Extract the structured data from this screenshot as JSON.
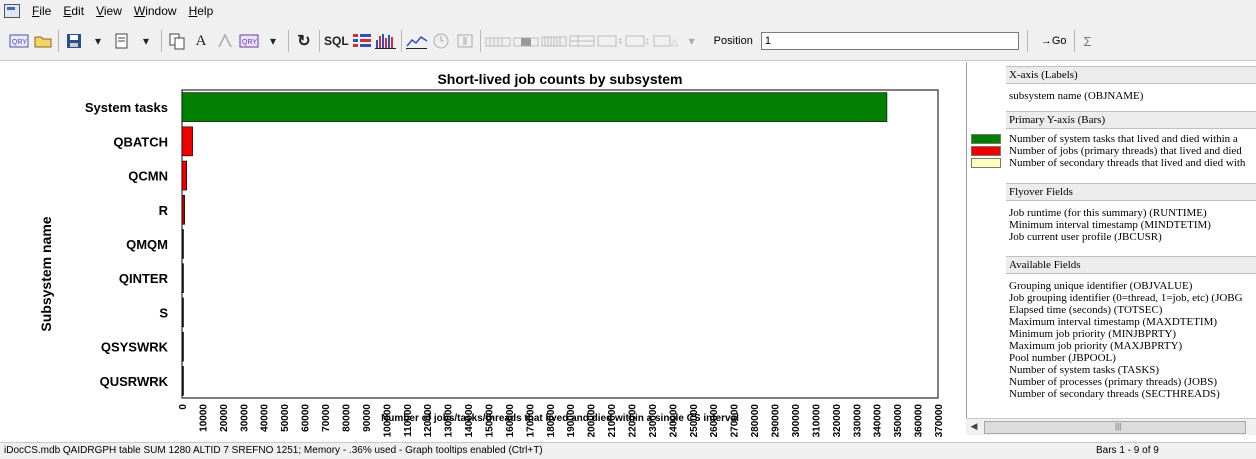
{
  "menu": {
    "items": [
      {
        "label": "File",
        "accel": "F",
        "rest": "ile"
      },
      {
        "label": "Edit",
        "accel": "E",
        "rest": "dit"
      },
      {
        "label": "View",
        "accel": "V",
        "rest": "iew"
      },
      {
        "label": "Window",
        "accel": "W",
        "rest": "indow"
      },
      {
        "label": "Help",
        "accel": "H",
        "rest": "elp"
      }
    ]
  },
  "toolbar": {
    "sql_label": "SQL",
    "position_label": "Position",
    "position_value": "1",
    "go_label": "→Go",
    "sigma_label": "Σ"
  },
  "chart_data": {
    "type": "bar",
    "orientation": "horizontal",
    "title": "Short-lived job counts by subsystem",
    "xlabel": "Number of jobs/tasks/threads that lived and died within a single CS interval",
    "ylabel": "Subsystem name",
    "categories": [
      "System tasks",
      "QBATCH",
      "QCMN",
      "R",
      "QMQM",
      "QINTER",
      "S",
      "QSYSWRK",
      "QUSRWRK"
    ],
    "series": [
      {
        "values": [
          345000,
          5200,
          2300,
          1300,
          600,
          450,
          350,
          150,
          100
        ],
        "color": "#007f00"
      }
    ],
    "bar_colors": [
      "#007f00",
      "#ee0000",
      "#ee0000",
      "#c00000",
      "#222222",
      "#222222",
      "#222222",
      "#222222",
      "#222222"
    ],
    "xlim": [
      0,
      370000
    ],
    "xticks": [
      0,
      10000,
      20000,
      30000,
      40000,
      50000,
      60000,
      70000,
      80000,
      90000,
      100000,
      110000,
      120000,
      130000,
      140000,
      150000,
      160000,
      170000,
      180000,
      190000,
      200000,
      210000,
      220000,
      230000,
      240000,
      250000,
      260000,
      270000,
      280000,
      290000,
      300000,
      310000,
      320000,
      330000,
      340000,
      350000,
      360000,
      370000
    ],
    "grid": false
  },
  "legend": {
    "xaxis_header": "X-axis (Labels)",
    "xaxis_field": "subsystem name (OBJNAME)",
    "yaxis_header": "Primary Y-axis (Bars)",
    "bars": [
      {
        "label": "Number of system tasks that lived and died within a",
        "color": "#007f00"
      },
      {
        "label": "Number of jobs (primary threads) that lived and died",
        "color": "#ee0000"
      },
      {
        "label": "Number of secondary threads that lived and died with",
        "color": "#ffffc0"
      }
    ],
    "flyover_header": "Flyover Fields",
    "flyover_fields": [
      "Job runtime (for this summary) (RUNTIME)",
      "Minimum interval timestamp (MINDTETIM)",
      "Job current user profile (JBCUSR)"
    ],
    "available_header": "Available Fields",
    "available_fields": [
      "Grouping unique identifier (OBJVALUE)",
      "Job grouping identifier (0=thread, 1=job, etc) (JOBG",
      "Elapsed time (seconds) (TOTSEC)",
      "Maximum interval timestamp (MAXDTETIM)",
      "Minimum job priority (MINJBPRTY)",
      "Maximum job priority (MAXJBPRTY)",
      "Pool number (JBPOOL)",
      "Number of system tasks (TASKS)",
      "Number of processes (primary threads) (JOBS)",
      "Number of secondary threads (SECTHREADS)"
    ]
  },
  "status": {
    "left": "iDocCS.mdb QAIDRGPH table SUM 1280 ALTID 7 SREFNO 1251; Memory - .36% used - Graph tooltips enabled (Ctrl+T)",
    "right": "Bars 1 - 9 of 9"
  }
}
